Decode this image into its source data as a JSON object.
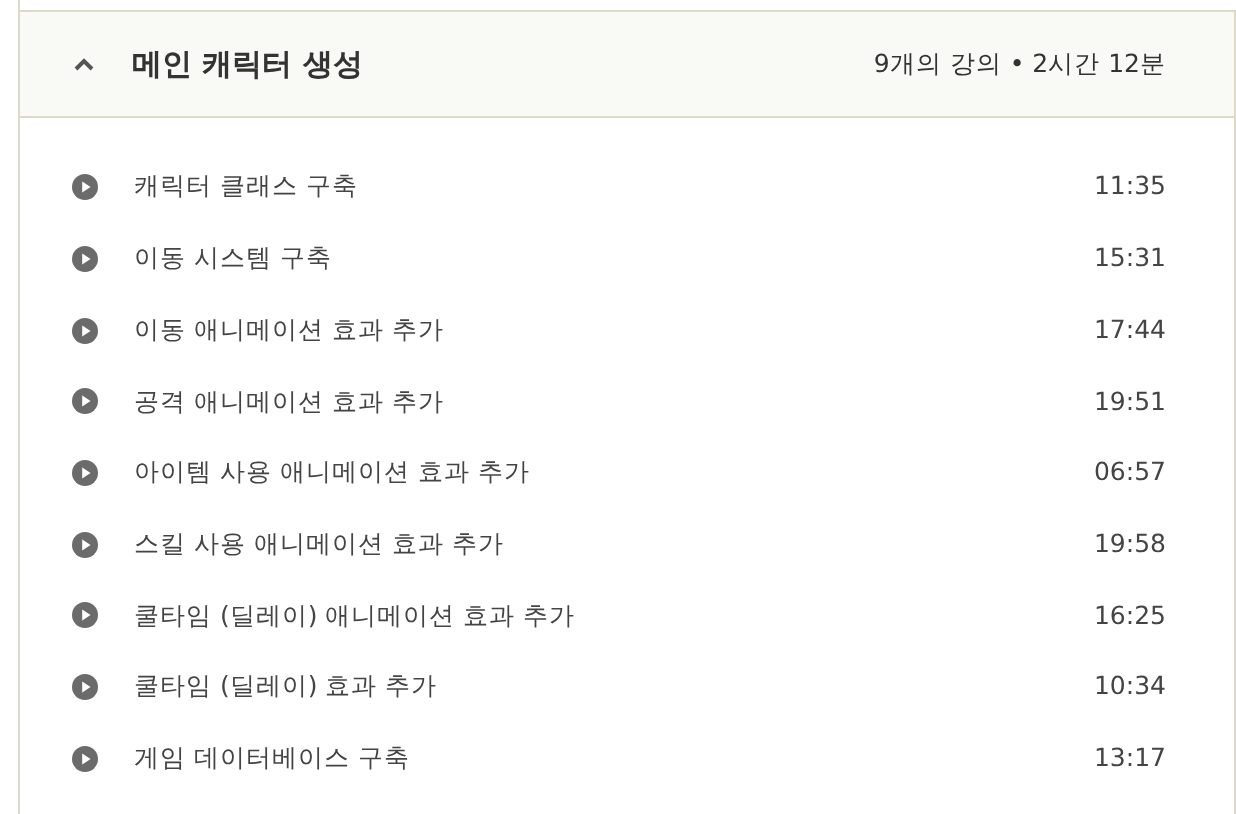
{
  "section": {
    "title": "메인 캐릭터 생성",
    "meta": "9개의 강의 • 2시간 12분",
    "expanded": true,
    "lectures": [
      {
        "title": "캐릭터 클래스 구축",
        "duration": "11:35"
      },
      {
        "title": "이동 시스템 구축",
        "duration": "15:31"
      },
      {
        "title": "이동 애니메이션 효과 추가",
        "duration": "17:44"
      },
      {
        "title": "공격 애니메이션 효과 추가",
        "duration": "19:51"
      },
      {
        "title": "아이템 사용 애니메이션 효과 추가",
        "duration": "06:57"
      },
      {
        "title": "스킬 사용 애니메이션 효과 추가",
        "duration": "19:58"
      },
      {
        "title": "쿨타임 (딜레이) 애니메이션 효과 추가",
        "duration": "16:25"
      },
      {
        "title": "쿨타임 (딜레이) 효과 추가",
        "duration": "10:34"
      },
      {
        "title": "게임 데이터베이스 구축",
        "duration": "13:17"
      }
    ]
  }
}
